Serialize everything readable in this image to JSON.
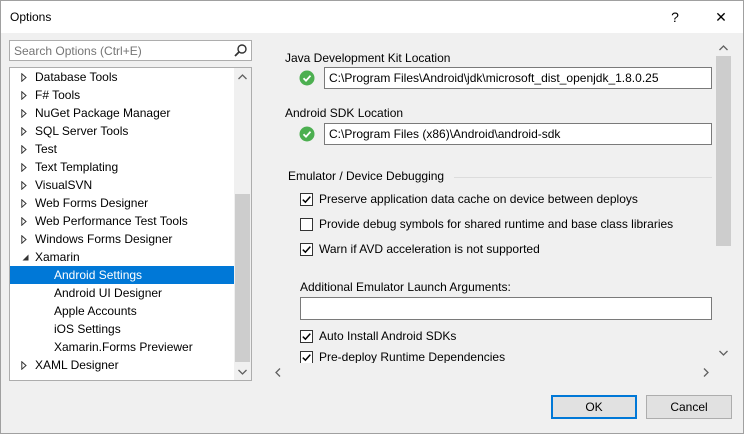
{
  "window": {
    "title": "Options",
    "help_glyph": "?",
    "close_glyph": "✕"
  },
  "search": {
    "placeholder": "Search Options (Ctrl+E)"
  },
  "tree": {
    "items": [
      {
        "label": "Database Tools",
        "level": 0,
        "expander": "collapsed"
      },
      {
        "label": "F# Tools",
        "level": 0,
        "expander": "collapsed"
      },
      {
        "label": "NuGet Package Manager",
        "level": 0,
        "expander": "collapsed"
      },
      {
        "label": "SQL Server Tools",
        "level": 0,
        "expander": "collapsed"
      },
      {
        "label": "Test",
        "level": 0,
        "expander": "collapsed"
      },
      {
        "label": "Text Templating",
        "level": 0,
        "expander": "collapsed"
      },
      {
        "label": "VisualSVN",
        "level": 0,
        "expander": "collapsed"
      },
      {
        "label": "Web Forms Designer",
        "level": 0,
        "expander": "collapsed"
      },
      {
        "label": "Web Performance Test Tools",
        "level": 0,
        "expander": "collapsed"
      },
      {
        "label": "Windows Forms Designer",
        "level": 0,
        "expander": "collapsed"
      },
      {
        "label": "Xamarin",
        "level": 0,
        "expander": "expanded"
      },
      {
        "label": "Android Settings",
        "level": 1,
        "expander": "none",
        "selected": true
      },
      {
        "label": "Android UI Designer",
        "level": 1,
        "expander": "none"
      },
      {
        "label": "Apple Accounts",
        "level": 1,
        "expander": "none"
      },
      {
        "label": "iOS Settings",
        "level": 1,
        "expander": "none"
      },
      {
        "label": "Xamarin.Forms Previewer",
        "level": 1,
        "expander": "none"
      },
      {
        "label": "XAML Designer",
        "level": 0,
        "expander": "collapsed"
      }
    ]
  },
  "settings": {
    "jdk_label": "Java Development Kit Location",
    "jdk_path": "C:\\Program Files\\Android\\jdk\\microsoft_dist_openjdk_1.8.0.25",
    "sdk_label": "Android SDK Location",
    "sdk_path": "C:\\Program Files (x86)\\Android\\android-sdk",
    "emulator_group": "Emulator / Device Debugging",
    "preserve_cache": {
      "label": "Preserve application data cache on device between deploys",
      "checked": true
    },
    "debug_symbols": {
      "label": "Provide debug symbols for shared runtime and base class libraries",
      "checked": false
    },
    "warn_avd": {
      "label": "Warn if AVD acceleration is not supported",
      "checked": true
    },
    "emulator_args_label": "Additional Emulator Launch Arguments:",
    "emulator_args_value": "",
    "auto_install": {
      "label": "Auto Install Android SDKs",
      "checked": true
    },
    "predeploy": {
      "label": "Pre-deploy Runtime Dependencies",
      "checked": true
    }
  },
  "buttons": {
    "ok": "OK",
    "cancel": "Cancel"
  },
  "colors": {
    "selection": "#0078d7",
    "status_ok": "#4caf50",
    "accent_border": "#0078d7"
  }
}
